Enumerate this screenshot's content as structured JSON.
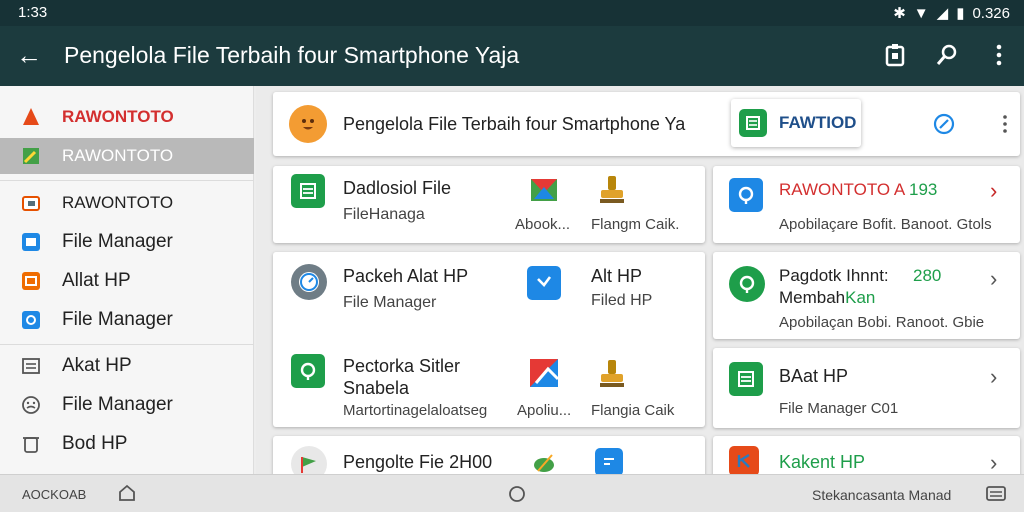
{
  "status": {
    "time": "1:33",
    "right_text": "0.326"
  },
  "appbar": {
    "title": "Pengelola File Terbaih four Smartphone Yaja"
  },
  "sidebar": {
    "items": [
      {
        "label": "RAWONTOTO",
        "icon": "flame-icon"
      },
      {
        "label": "RAWONTOTO",
        "icon": "shortcut-icon"
      },
      {
        "label": "RAWONTOTO",
        "icon": "folder-icon"
      },
      {
        "label": "File Manager",
        "icon": "app-icon"
      },
      {
        "label": "Allat HP",
        "icon": "tool-icon"
      },
      {
        "label": "File Manager",
        "icon": "app-icon"
      },
      {
        "label": "Akat HP",
        "icon": "list-icon"
      },
      {
        "label": "File Manager",
        "icon": "emoji-icon"
      },
      {
        "label": "Bod HP",
        "icon": "bin-icon"
      }
    ]
  },
  "header_card": {
    "text": "Pengelola File Terbaih four Smartphone Ya",
    "button": "FAWTIOD"
  },
  "left_cards": [
    {
      "title": "Dadlosiol File",
      "sub": "FileHanaga",
      "a_label": "Abook...",
      "b_label": "Flangm Caik."
    },
    {
      "title": "Packeh Alat HP",
      "sub": "File Manager",
      "a_label": "Alt HP",
      "b_label": "Filed HP"
    },
    {
      "title": "Pectorka Sitler",
      "title2": "Snabela",
      "sub": "Martortinagelaloatseg",
      "a_label": "Apoliu...",
      "b_label": "Flangia Caik"
    },
    {
      "title": "Pengolte Fie 2H00"
    }
  ],
  "right_cards": [
    {
      "title": "RAWONTOTO A",
      "num": "193",
      "sub": "Apobilaçare Bofit. Banoot. Gtols"
    },
    {
      "title": "Pagdotk Ihnnt:",
      "num": "280",
      "title2a": "Membah",
      "title2b": "Kan",
      "sub": "Apobilaçan Bobi. Ranoot. Gbie"
    },
    {
      "title": "BAat HP",
      "sub": "File Manager C01"
    },
    {
      "title": "Kakent HP"
    }
  ],
  "navbar": {
    "left": "AOCKOAB",
    "right": "Stekancasanta Manad"
  },
  "colors": {
    "appbar": "#1c3b3e",
    "status": "#173236",
    "red": "#d32f2f",
    "green": "#1e9e4a"
  }
}
